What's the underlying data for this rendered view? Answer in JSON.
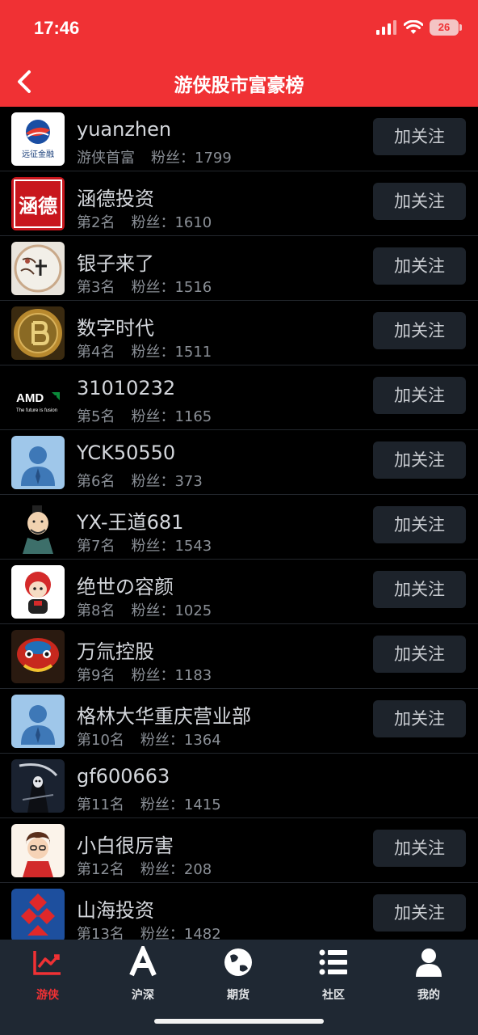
{
  "status_bar": {
    "time": "17:46",
    "battery": "26"
  },
  "nav": {
    "title": "游侠股市富豪榜"
  },
  "colors": {
    "accent": "#f03134",
    "tab_bar": "#1f2833",
    "button_bg": "#1d232b"
  },
  "rows": [
    {
      "name": "yuanzhen",
      "rank": "游侠首富",
      "fans_label": "粉丝：",
      "fans": "1799",
      "button": "加关注"
    },
    {
      "name": "涵德投资",
      "rank": "第2名",
      "fans_label": "粉丝：",
      "fans": "1610",
      "button": "加关注"
    },
    {
      "name": "银子来了",
      "rank": "第3名",
      "fans_label": "粉丝：",
      "fans": "1516",
      "button": "加关注"
    },
    {
      "name": "数字时代",
      "rank": "第4名",
      "fans_label": "粉丝：",
      "fans": "1511",
      "button": "加关注"
    },
    {
      "name": "31010232",
      "rank": "第5名",
      "fans_label": "粉丝：",
      "fans": "1165",
      "button": "加关注"
    },
    {
      "name": "YCK50550",
      "rank": "第6名",
      "fans_label": "粉丝：",
      "fans": "373",
      "button": "加关注"
    },
    {
      "name": "YX-王道681",
      "rank": "第7名",
      "fans_label": "粉丝：",
      "fans": "1543",
      "button": "加关注"
    },
    {
      "name": "绝世の容颜",
      "rank": "第8名",
      "fans_label": "粉丝：",
      "fans": "1025",
      "button": "加关注"
    },
    {
      "name": "万氚控股",
      "rank": "第9名",
      "fans_label": "粉丝：",
      "fans": "1183",
      "button": "加关注"
    },
    {
      "name": "格林大华重庆营业部",
      "rank": "第10名",
      "fans_label": "粉丝：",
      "fans": "1364",
      "button": "加关注"
    },
    {
      "name": "gf600663",
      "rank": "第11名",
      "fans_label": "粉丝：",
      "fans": "1415"
    },
    {
      "name": "小白很厉害",
      "rank": "第12名",
      "fans_label": "粉丝：",
      "fans": "208",
      "button": "加关注"
    },
    {
      "name": "山海投资",
      "rank": "第13名",
      "fans_label": "粉丝：",
      "fans": "1482",
      "button": "加关注"
    }
  ],
  "avatars": {
    "r0": {
      "brand_text": "远征金融"
    },
    "r1": {
      "text": "涵德"
    },
    "r4": {
      "logo": "AMD",
      "tagline": "The future is fusion"
    }
  },
  "tabs": [
    {
      "label": "游侠",
      "icon": "chart-line-icon",
      "active": true
    },
    {
      "label": "沪深",
      "icon": "letter-a-icon"
    },
    {
      "label": "期货",
      "icon": "globe-icon"
    },
    {
      "label": "社区",
      "icon": "list-icon"
    },
    {
      "label": "我的",
      "icon": "user-icon"
    }
  ]
}
